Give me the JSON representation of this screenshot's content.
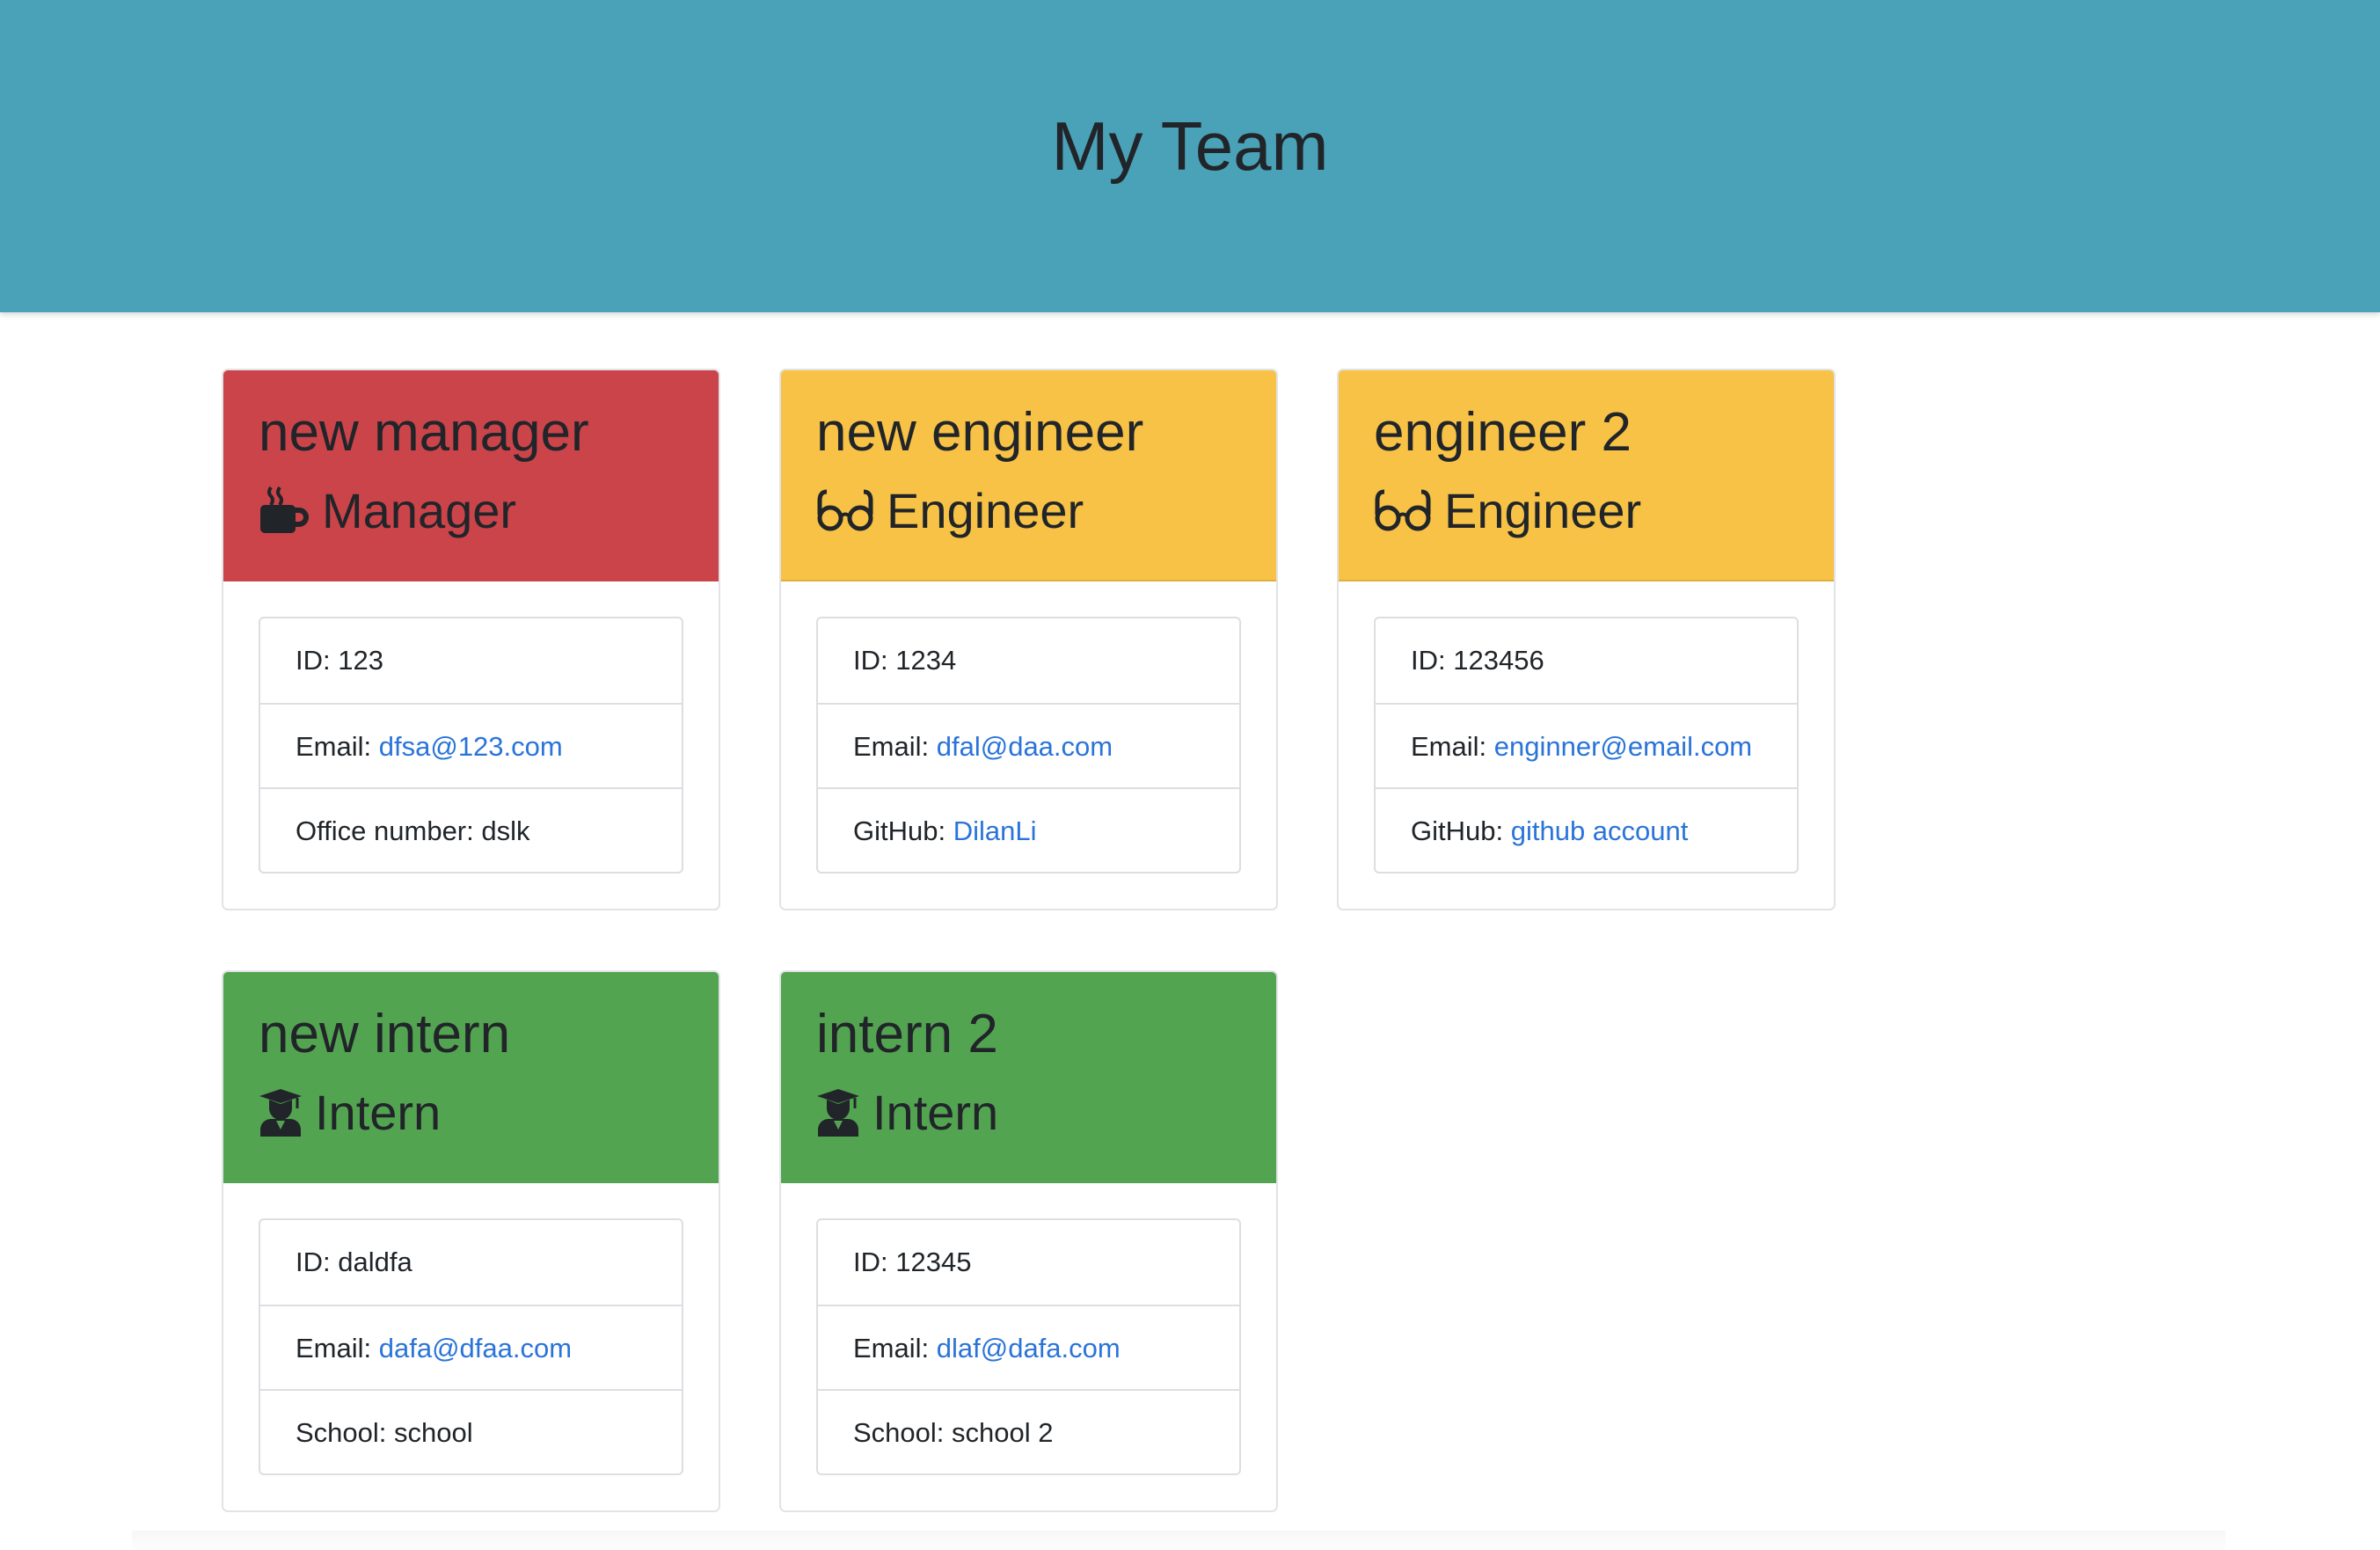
{
  "page": {
    "title": "My Team",
    "header_color": "#4aa2b8"
  },
  "colors": {
    "manager": "#cb444a",
    "engineer": "#f7c245",
    "intern": "#53a451",
    "link": "#2a74d8"
  },
  "cards": [
    {
      "name": "new manager",
      "role": "Manager",
      "icon": "coffee-icon",
      "rows": [
        {
          "label": "ID: ",
          "value": "123"
        },
        {
          "label": "Email: ",
          "value": "dfsa@123.com",
          "link": true
        },
        {
          "label": "Office number: ",
          "value": "dslk"
        }
      ]
    },
    {
      "name": "new engineer",
      "role": "Engineer",
      "icon": "glasses-icon",
      "rows": [
        {
          "label": "ID: ",
          "value": "1234"
        },
        {
          "label": "Email: ",
          "value": "dfal@daa.com",
          "link": true
        },
        {
          "label": "GitHub: ",
          "value": "DilanLi",
          "link": true
        }
      ]
    },
    {
      "name": "engineer 2",
      "role": "Engineer",
      "icon": "glasses-icon",
      "rows": [
        {
          "label": "ID: ",
          "value": "123456"
        },
        {
          "label": "Email: ",
          "value": "enginner@email.com",
          "link": true
        },
        {
          "label": "GitHub: ",
          "value": "github account",
          "link": true
        }
      ]
    },
    {
      "name": "new intern",
      "role": "Intern",
      "icon": "graduate-icon",
      "rows": [
        {
          "label": "ID: ",
          "value": "daldfa"
        },
        {
          "label": "Email: ",
          "value": "dafa@dfaa.com",
          "link": true
        },
        {
          "label": "School: ",
          "value": "school"
        }
      ]
    },
    {
      "name": "intern 2",
      "role": "Intern",
      "icon": "graduate-icon",
      "rows": [
        {
          "label": "ID: ",
          "value": "12345"
        },
        {
          "label": "Email: ",
          "value": "dlaf@dafa.com",
          "link": true
        },
        {
          "label": "School: ",
          "value": "school 2"
        }
      ]
    }
  ]
}
